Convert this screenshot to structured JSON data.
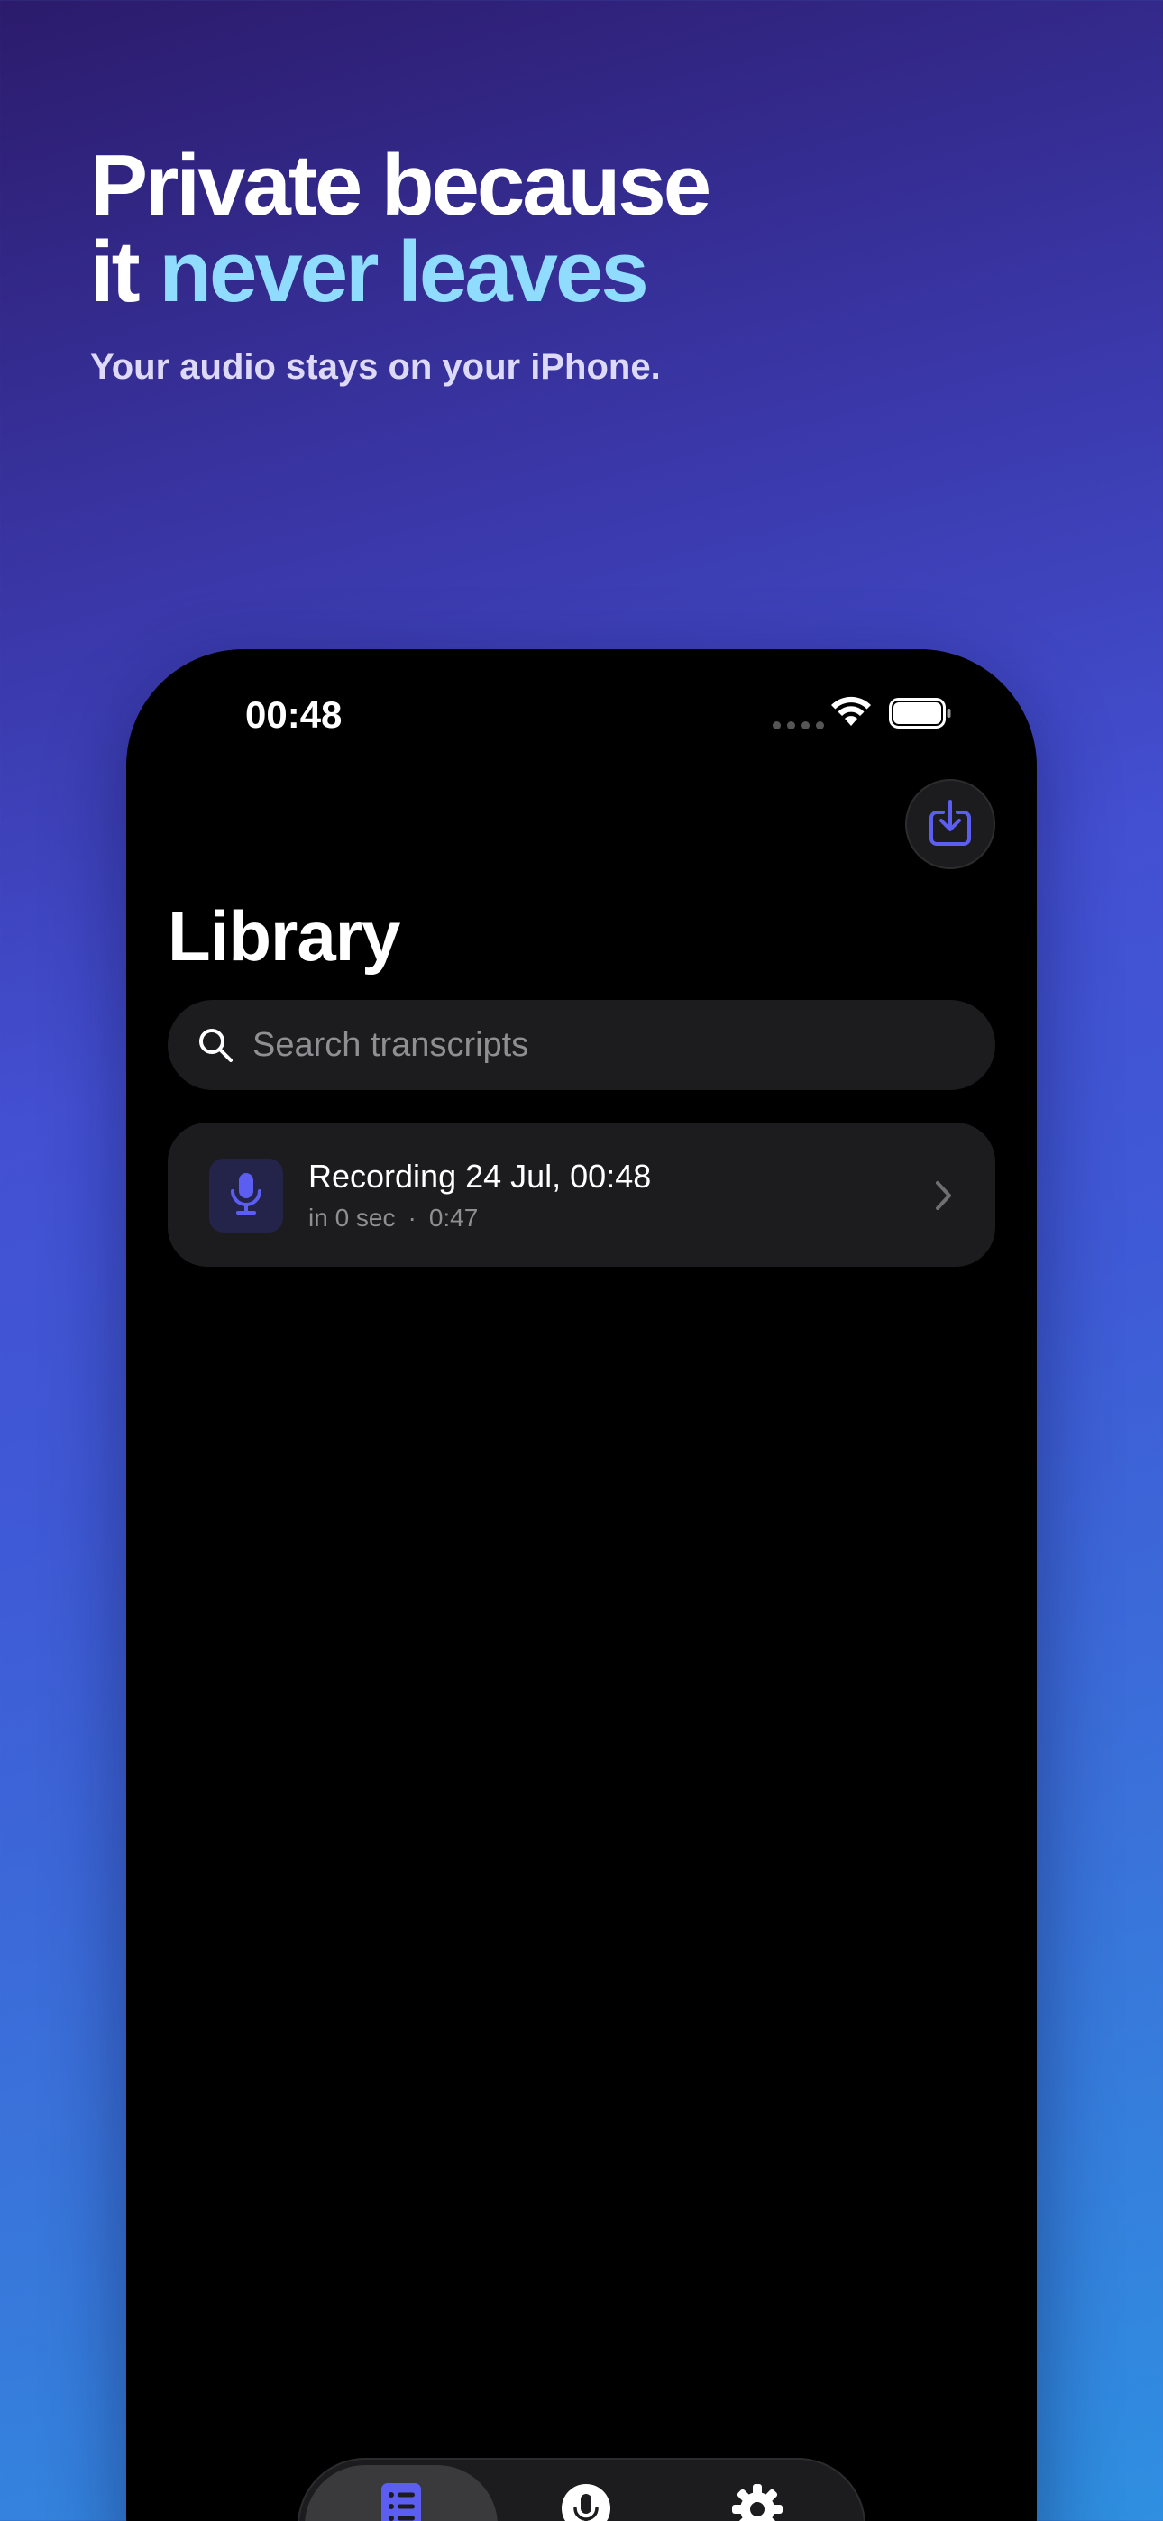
{
  "promo": {
    "headline_line1": "Private because",
    "headline_line2_prefix": "it ",
    "headline_line2_accent": "never leaves",
    "subheadline": "Your audio stays on your iPhone.",
    "accent_color": "#8fdcff"
  },
  "status_bar": {
    "time": "00:48"
  },
  "toolbar": {
    "export_icon": "square-arrow-down-icon"
  },
  "library": {
    "title": "Library",
    "search": {
      "placeholder": "Search transcripts",
      "value": ""
    },
    "recordings": [
      {
        "title": "Recording 24 Jul, 00:48",
        "meta_time": "in 0 sec",
        "separator": "·",
        "duration": "0:47",
        "icon": "mic-icon"
      }
    ]
  },
  "tab_bar": {
    "tabs": [
      {
        "name": "library",
        "icon": "list-icon",
        "selected": true
      },
      {
        "name": "record",
        "icon": "mic-circle-icon",
        "selected": false
      },
      {
        "name": "settings",
        "icon": "gear-icon",
        "selected": false
      }
    ]
  },
  "colors": {
    "brand_purple": "#5b5ef0",
    "card_background": "#1c1c1e"
  }
}
